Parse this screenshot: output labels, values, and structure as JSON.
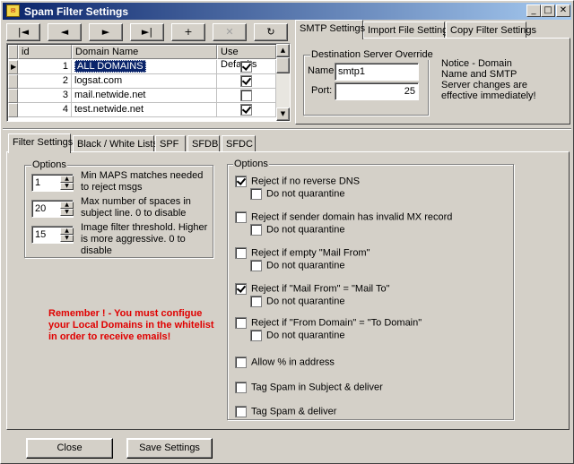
{
  "window": {
    "title": "Spam Filter Settings",
    "icon": "spam-app-icon",
    "controls": [
      "minimize-icon",
      "maximize-icon",
      "close-icon"
    ]
  },
  "navigator": {
    "buttons": [
      {
        "icon": "first-record-icon",
        "glyph": "|◄"
      },
      {
        "icon": "prior-record-icon",
        "glyph": "◄"
      },
      {
        "icon": "next-record-icon",
        "glyph": "►"
      },
      {
        "icon": "last-record-icon",
        "glyph": "►|"
      },
      {
        "icon": "insert-record-icon",
        "glyph": "+"
      },
      {
        "icon": "delete-record-icon",
        "glyph": "✕"
      },
      {
        "icon": "refresh-icon",
        "glyph": "↻"
      }
    ]
  },
  "grid": {
    "columns": [
      "id",
      "Domain Name",
      "Use Defaults"
    ],
    "rows": [
      {
        "id": "1",
        "domain": "ALL DOMAINS",
        "use_defaults": true,
        "selected": true
      },
      {
        "id": "2",
        "domain": "logsat.com",
        "use_defaults": true,
        "selected": false
      },
      {
        "id": "3",
        "domain": "mail.netwide.net",
        "use_defaults": false,
        "selected": false
      },
      {
        "id": "4",
        "domain": "test.netwide.net",
        "use_defaults": true,
        "selected": false
      }
    ]
  },
  "top_tabs": {
    "tabs": [
      "SMTP Settings",
      "Import File Settings",
      "Copy Filter Settings"
    ],
    "active": 0
  },
  "smtp": {
    "group_label": "Destination Server Override",
    "name_label": "Name:",
    "name_value": "smtp1",
    "port_label": "Port:",
    "port_value": "25",
    "notice": "Notice - Domain Name and SMTP Server changes are effective immediately!"
  },
  "bottom_tabs": {
    "tabs": [
      "Filter Settings",
      "Black / White Lists",
      "SPF",
      "SFDB",
      "SFDC"
    ],
    "active": 0
  },
  "left_options": {
    "group_label": "Options",
    "spinners": [
      {
        "value": "1",
        "label": "Min MAPS matches needed to reject msgs"
      },
      {
        "value": "20",
        "label": "Max number of spaces in subject line. 0 to disable"
      },
      {
        "value": "15",
        "label": "Image filter threshold. Higher is more aggressive. 0 to disable"
      }
    ]
  },
  "reminder": "Remember ! - You must configue your Local Domains in the whitelist in order to receive emails!",
  "right_options": {
    "group_label": "Options",
    "items": [
      {
        "label": "Reject if no reverse DNS",
        "checked": true,
        "sub": "Do not quarantine",
        "sub_checked": false
      },
      {
        "label": "Reject if sender domain has invalid MX record",
        "checked": false,
        "sub": "Do not quarantine",
        "sub_checked": false
      },
      {
        "label": "Reject if empty \"Mail From\"",
        "checked": false,
        "sub": "Do not quarantine",
        "sub_checked": false
      },
      {
        "label": "Reject if \"Mail From\" = \"Mail To\"",
        "checked": true,
        "sub": "Do not quarantine",
        "sub_checked": false
      },
      {
        "label": "Reject if \"From Domain\" = \"To Domain\"",
        "checked": false,
        "sub": "Do not quarantine",
        "sub_checked": false
      },
      {
        "label": "Allow % in address",
        "checked": false
      },
      {
        "label": "Tag Spam in Subject & deliver",
        "checked": false
      },
      {
        "label": "Tag Spam & deliver",
        "checked": false
      }
    ]
  },
  "footer": {
    "close_label": "Close",
    "save_label": "Save Settings"
  },
  "colors": {
    "title_start": "#0a246a",
    "title_end": "#a6caf0",
    "selection": "#0a246a",
    "reminder": "#e00000",
    "face": "#d4d0c8"
  }
}
